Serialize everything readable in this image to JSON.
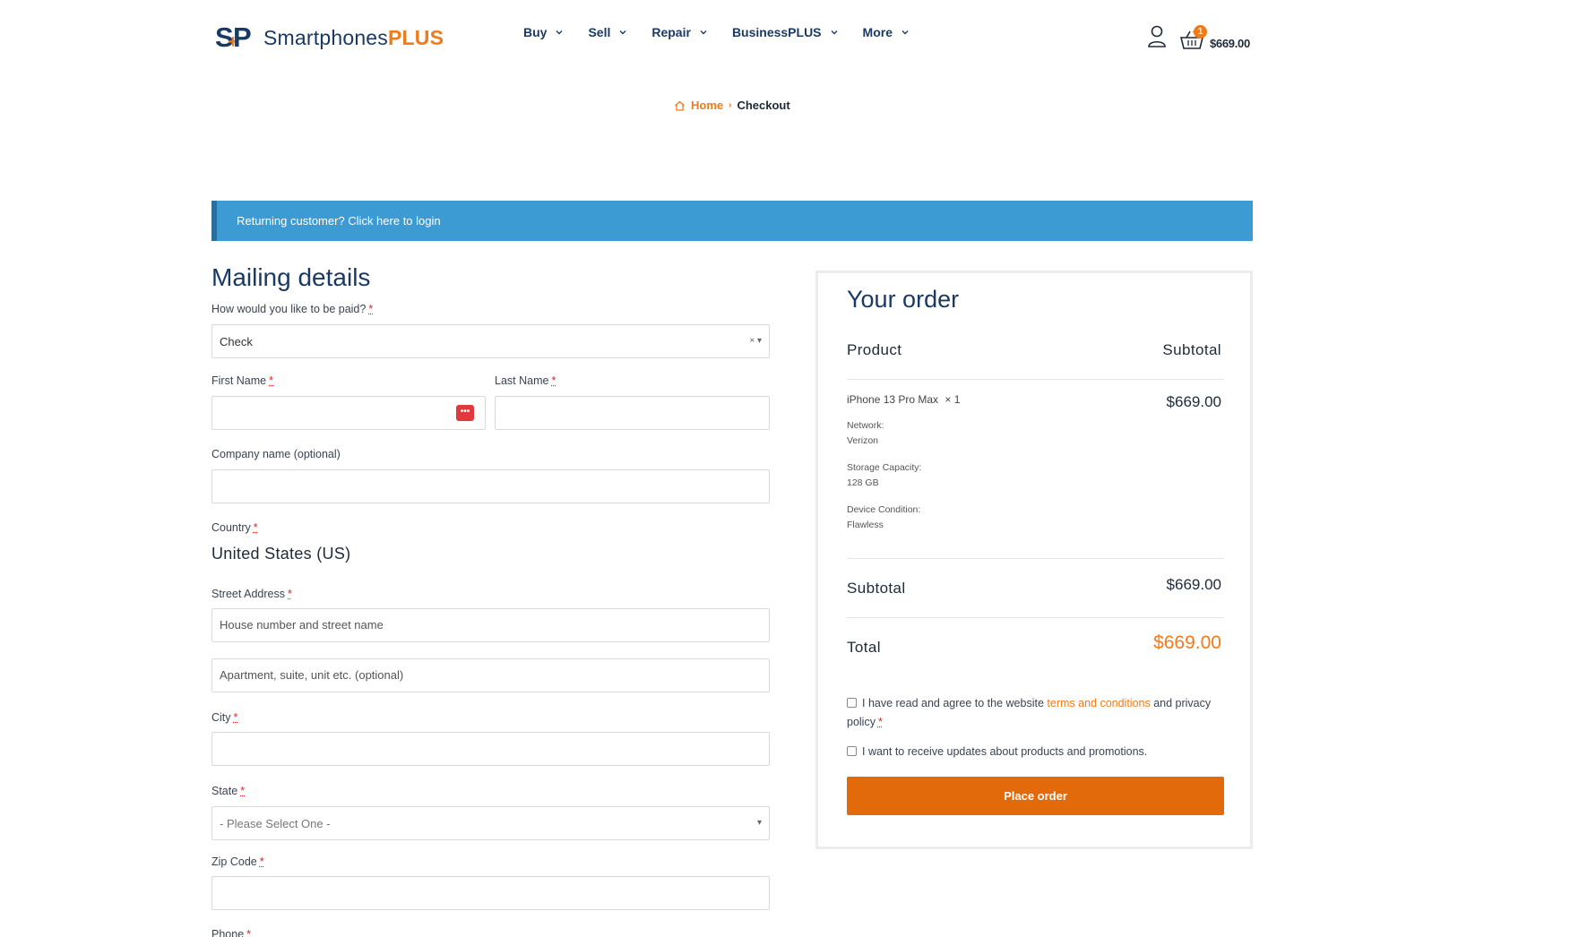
{
  "header": {
    "logo": {
      "mark_s": "S",
      "mark_p": "P",
      "text_main": "Smartphones",
      "text_accent": "PLUS"
    },
    "nav": [
      {
        "label": "Buy"
      },
      {
        "label": "Sell"
      },
      {
        "label": "Repair"
      },
      {
        "label": "BusinessPLUS"
      },
      {
        "label": "More"
      }
    ],
    "cart": {
      "count": "1",
      "total": "$669.00"
    }
  },
  "breadcrumb": {
    "home": "Home",
    "separator": "›",
    "current": "Checkout"
  },
  "notice": {
    "text": "Returning customer? Click here to login"
  },
  "mailing": {
    "title": "Mailing details",
    "payment": {
      "label": "How would you like to be paid?",
      "required": "*",
      "value": "Check"
    },
    "first_name": {
      "label": "First Name",
      "required": "*",
      "value": ""
    },
    "last_name": {
      "label": "Last Name",
      "required": "*",
      "value": ""
    },
    "company": {
      "label": "Company name (optional)",
      "value": ""
    },
    "country": {
      "label": "Country",
      "required": "*",
      "value": "United States (US)"
    },
    "street": {
      "label": "Street Address",
      "required": "*",
      "placeholder1": "House number and street name",
      "placeholder2": "Apartment, suite, unit etc. (optional)"
    },
    "city": {
      "label": "City",
      "required": "*",
      "value": ""
    },
    "state": {
      "label": "State",
      "required": "*",
      "value": "- Please Select One -"
    },
    "zip": {
      "label": "Zip Code",
      "required": "*",
      "value": ""
    },
    "phone": {
      "label": "Phone",
      "required": "*"
    }
  },
  "order": {
    "title": "Your order",
    "col_product": "Product",
    "col_subtotal": "Subtotal",
    "item": {
      "name": "iPhone 13 Pro Max",
      "qty": "× 1",
      "price": "$669.00",
      "meta": [
        {
          "key": "Network:",
          "value": "Verizon"
        },
        {
          "key": "Storage Capacity:",
          "value": "128 GB"
        },
        {
          "key": "Device Condition:",
          "value": "Flawless"
        }
      ]
    },
    "subtotal_label": "Subtotal",
    "subtotal_value": "$669.00",
    "total_label": "Total",
    "total_value": "$669.00",
    "terms_pre": "I have read and agree to the website ",
    "terms_link": "terms and conditions",
    "terms_post": " and privacy policy",
    "terms_required": "*",
    "updates_text": "I want to receive updates about products and promotions.",
    "place_order": "Place order"
  },
  "colors": {
    "accent": "#f07b1a",
    "brand": "#1b3a63",
    "notice": "#3d9bd3",
    "button": "#e36a0a"
  }
}
